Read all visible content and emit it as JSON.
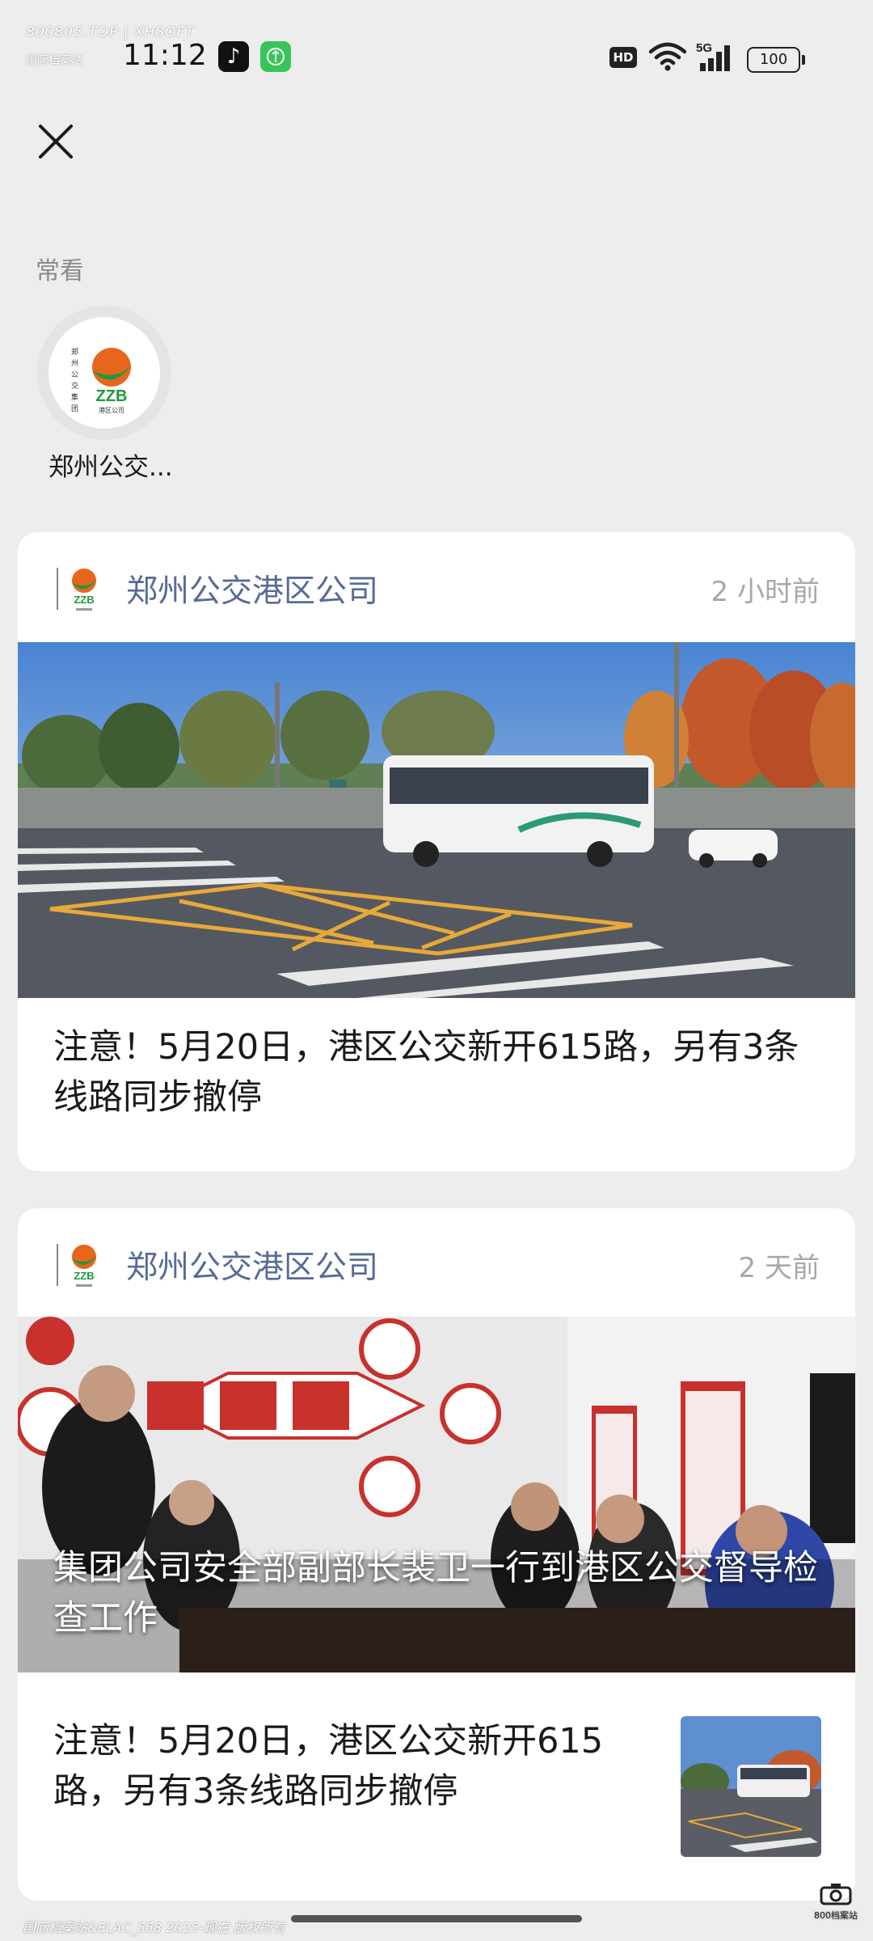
{
  "watermark": {
    "top_line1": "800805.TOP | XHSOFT",
    "top_line2": "国际档案站",
    "bottom": "国际档案站&ELAC_558 2025-现在 版权所有",
    "camera_label": "800档案站"
  },
  "status_bar": {
    "time": "11:12",
    "hd": "HD",
    "network": "5G",
    "battery": "100"
  },
  "header": {
    "close_icon": "close-icon"
  },
  "frequent": {
    "label": "常看",
    "accounts": [
      {
        "name": "郑州公交...",
        "logo_text": "ZZB",
        "logo_sub": "港区公司",
        "logo_side": "郑州公交集团"
      }
    ]
  },
  "feed": [
    {
      "account": "郑州公交港区公司",
      "time": "2 小时前",
      "headline": "注意！5月20日，港区公交新开615路，另有3条线路同步撤停"
    },
    {
      "account": "郑州公交港区公司",
      "time": "2 天前",
      "cover_title": "集团公司安全部副部长裴卫一行到港区公交督导检查工作",
      "related": "注意！5月20日，港区公交新开615路，另有3条线路同步撤停"
    }
  ],
  "colors": {
    "accent": "#576b95",
    "background": "#ededed"
  }
}
